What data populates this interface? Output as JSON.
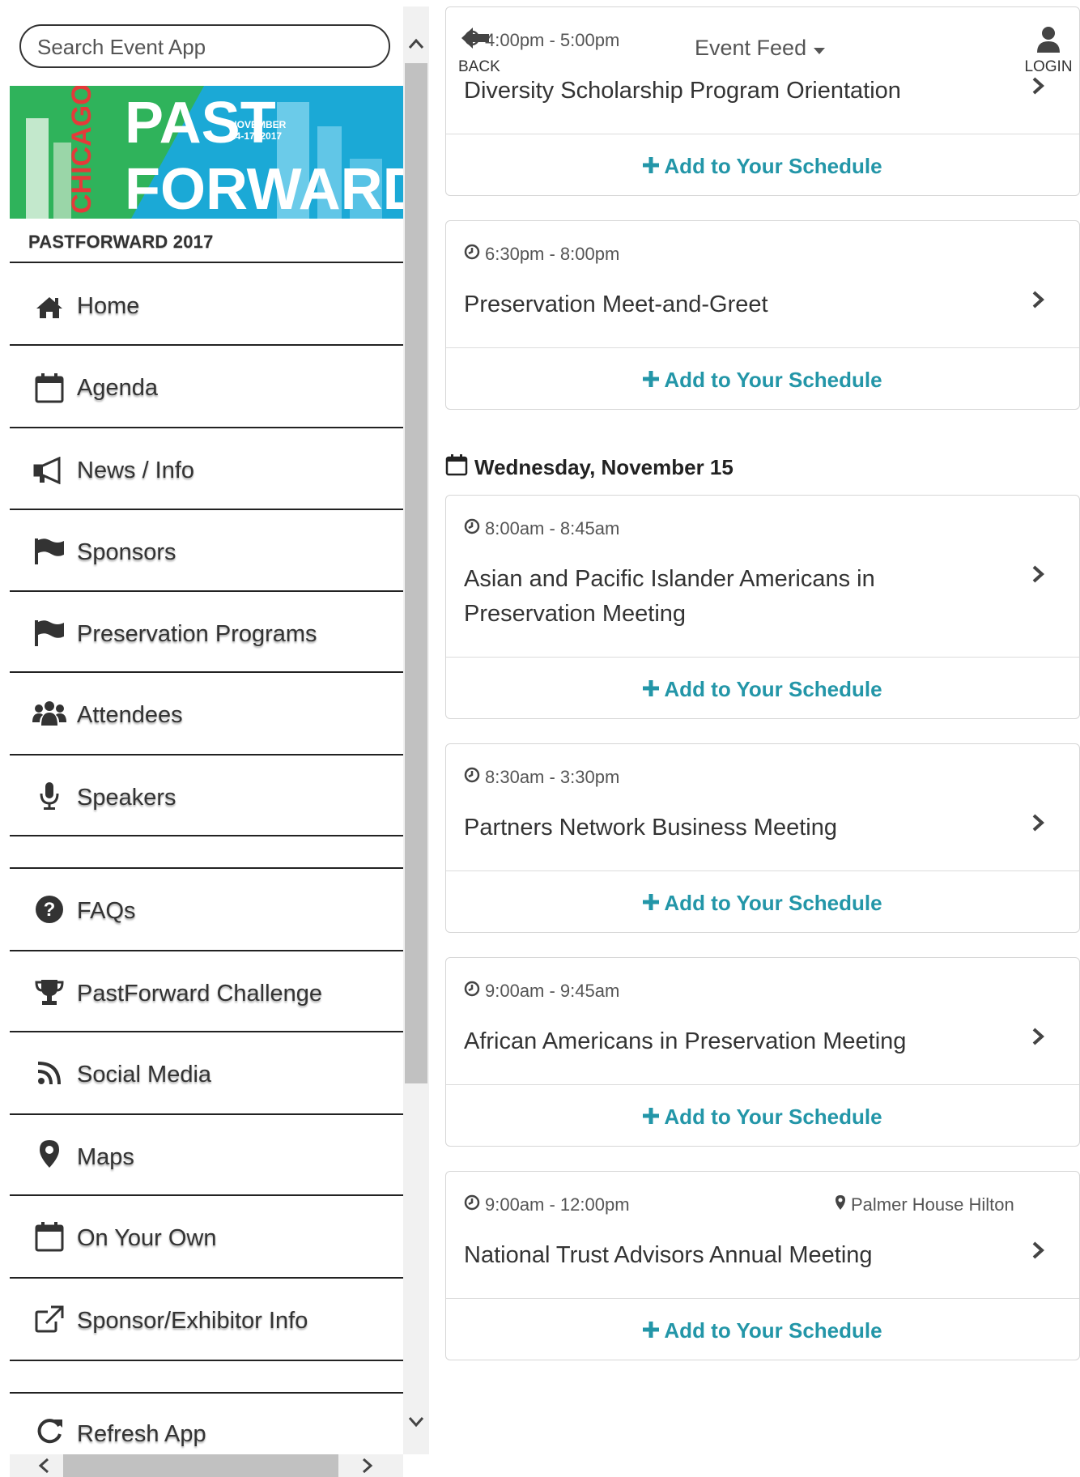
{
  "search": {
    "placeholder": "Search Event App"
  },
  "banner": {
    "city": "CHICAGO",
    "word1": "PAST",
    "word2": "FORWARD",
    "date_line1": "NOVEMBER",
    "date_line2": "14-17, 2017"
  },
  "event_name": "PASTFORWARD 2017",
  "nav": [
    {
      "label": "Home",
      "icon": "home-icon"
    },
    {
      "label": "Agenda",
      "icon": "calendar-icon"
    },
    {
      "label": "News / Info",
      "icon": "megaphone-icon"
    },
    {
      "label": "Sponsors",
      "icon": "flag-icon"
    },
    {
      "label": "Preservation Programs",
      "icon": "flag-icon"
    },
    {
      "label": "Attendees",
      "icon": "users-icon"
    },
    {
      "label": "Speakers",
      "icon": "microphone-icon"
    },
    {
      "label": "FAQs",
      "icon": "question-icon"
    },
    {
      "label": "PastForward Challenge",
      "icon": "trophy-icon"
    },
    {
      "label": "Social Media",
      "icon": "rss-icon"
    },
    {
      "label": "Maps",
      "icon": "map-marker-icon"
    },
    {
      "label": "On Your Own",
      "icon": "calendar-icon"
    },
    {
      "label": "Sponsor/Exhibitor Info",
      "icon": "external-link-icon"
    },
    {
      "label": "Refresh App",
      "icon": "refresh-icon"
    }
  ],
  "header": {
    "back_label": "BACK",
    "feed_title": "Event Feed",
    "login_label": "LOGIN"
  },
  "day_header": "Wednesday, November 15",
  "add_label": "Add to Your Schedule",
  "sessions": [
    {
      "time": "4:00pm - 5:00pm",
      "title": "Diversity Scholarship Program Orientation",
      "location": ""
    },
    {
      "time": "6:30pm - 8:00pm",
      "title": "Preservation Meet-and-Greet",
      "location": ""
    },
    {
      "time": "8:00am - 8:45am",
      "title": "Asian and Pacific Islander Americans in Preservation Meeting",
      "location": ""
    },
    {
      "time": "8:30am - 3:30pm",
      "title": "Partners Network Business Meeting",
      "location": ""
    },
    {
      "time": "9:00am - 9:45am",
      "title": "African Americans in Preservation Meeting",
      "location": ""
    },
    {
      "time": "9:00am - 12:00pm",
      "title": "National Trust Advisors Annual Meeting",
      "location": "Palmer House Hilton"
    }
  ],
  "colors": {
    "accent": "#2396a8",
    "banner_blue": "#1ba9d6",
    "banner_green": "#2fb35b"
  }
}
